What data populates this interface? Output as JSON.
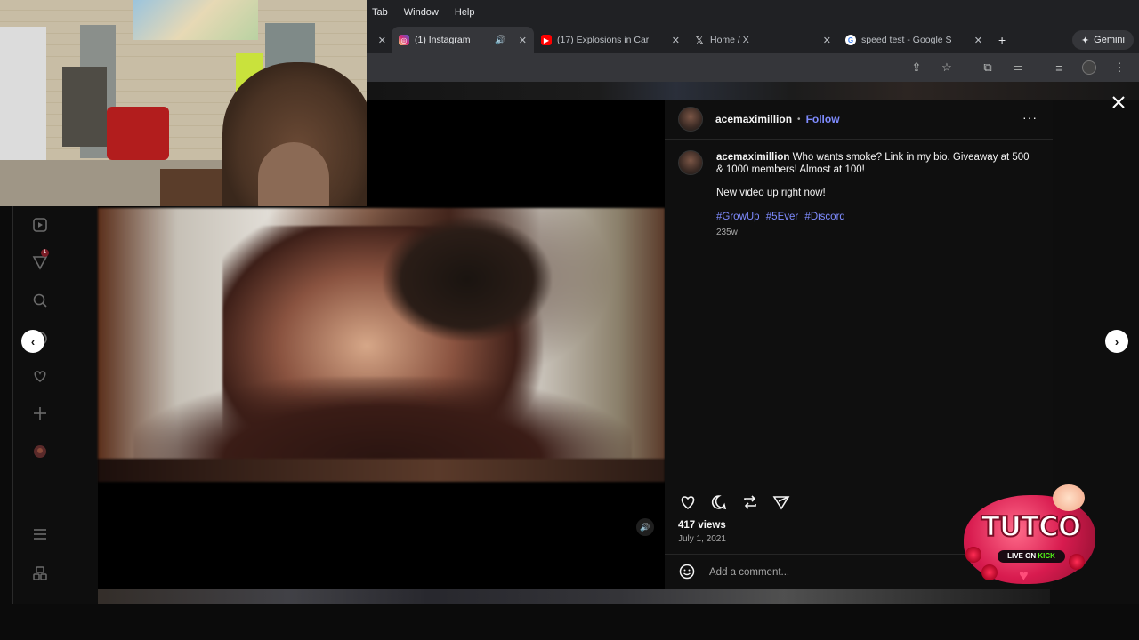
{
  "menubar": {
    "items": [
      "Tab",
      "Window",
      "Help"
    ]
  },
  "tabs": [
    {
      "title": "(1) Instagram",
      "active": true,
      "favicon": "instagram-icon",
      "favicon_color": "#d62976",
      "audible": true
    },
    {
      "title": "(17) Explosions in Car",
      "active": false,
      "favicon": "youtube-icon",
      "favicon_color": "#ff0000",
      "audible": false
    },
    {
      "title": "Home / X",
      "active": false,
      "favicon": "x-icon",
      "favicon_color": "#000000",
      "audible": false
    },
    {
      "title": "speed test - Google S",
      "active": false,
      "favicon": "google-icon",
      "favicon_color": "#4285f4",
      "audible": false
    }
  ],
  "gemini": {
    "label": "Gemini"
  },
  "post": {
    "username": "acemaximillion",
    "separator": "•",
    "follow_label": "Follow",
    "more_label": "···",
    "caption": {
      "username": "acemaximillion",
      "text": "Who wants smoke? Link in my bio. Giveaway at 500 & 1000 members! Almost at 100!",
      "line2": "New video up right now!"
    },
    "hashtags": [
      "#GrowUp",
      "#5Ever",
      "#Discord"
    ],
    "age": "235w",
    "views": "417 views",
    "date": "July 1, 2021",
    "comment_placeholder": "Add a comment..."
  },
  "sidebar": {
    "notification_count": "1",
    "items": [
      "reels-icon",
      "messages-icon",
      "search-icon",
      "explore-icon",
      "heart-icon",
      "create-icon",
      "profile-icon",
      "menu-icon",
      "more-icon"
    ]
  },
  "sticker": {
    "word": "TUTCO",
    "pill_prefix": "LIVE ON",
    "pill_brand": "KICK"
  },
  "colors": {
    "accent_link": "#7f8cff",
    "panel_bg": "#0f0f0f",
    "browser_chrome": "#202124"
  }
}
